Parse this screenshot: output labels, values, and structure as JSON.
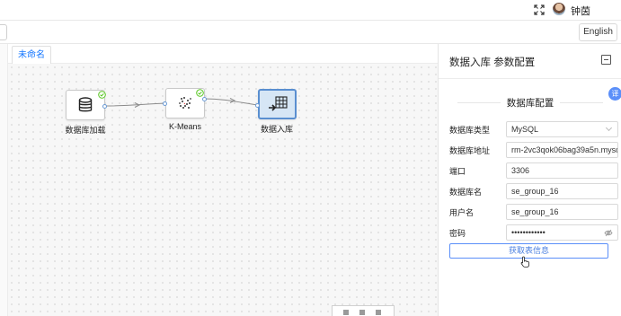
{
  "header": {
    "username": "钟茵",
    "expand_icon": "fullscreen-icon",
    "avatar_icon": "user-avatar"
  },
  "toolbar": {
    "language_button": "English"
  },
  "canvas": {
    "tab_label": "未命名",
    "nodes": [
      {
        "label": "数据库加载",
        "icon": "database-icon",
        "status": "success"
      },
      {
        "label": "K-Means",
        "icon": "cluster-icon",
        "status": "success"
      },
      {
        "label": "数据入库",
        "icon": "table-import-icon",
        "status": "selected"
      }
    ]
  },
  "panel": {
    "title": "数据入库 参数配置",
    "section_title": "数据库配置",
    "fields": {
      "db_type": {
        "label": "数据库类型",
        "value": "MySQL"
      },
      "db_host": {
        "label": "数据库地址",
        "value": "rm-2vc3qok06bag39a5n.mysq"
      },
      "port": {
        "label": "端口",
        "value": "3306"
      },
      "db_name": {
        "label": "数据库名",
        "value": "se_group_16"
      },
      "username": {
        "label": "用户名",
        "value": "se_group_16"
      },
      "password": {
        "label": "密码",
        "value": "••••••••••••"
      }
    },
    "fetch_button": "获取表信息"
  },
  "colors": {
    "accent": "#1677ff",
    "selected_node_bg": "#d6e6f5",
    "success": "#52c41a"
  }
}
